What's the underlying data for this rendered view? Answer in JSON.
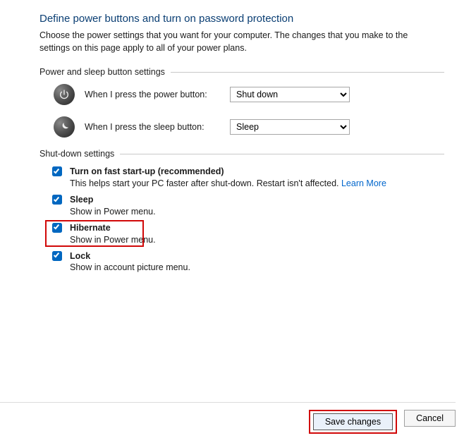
{
  "heading": "Define power buttons and turn on password protection",
  "description": "Choose the power settings that you want for your computer. The changes that you make to the settings on this page apply to all of your power plans.",
  "section_buttons": "Power and sleep button settings",
  "power_button": {
    "label": "When I press the power button:",
    "value": "Shut down"
  },
  "sleep_button": {
    "label": "When I press the sleep button:",
    "value": "Sleep"
  },
  "section_shutdown": "Shut-down settings",
  "settings": {
    "fast_startup": {
      "title": "Turn on fast start-up (recommended)",
      "desc_pre": "This helps start your PC faster after shut-down. Restart isn't affected. ",
      "learn_more": "Learn More"
    },
    "sleep": {
      "title": "Sleep",
      "desc": "Show in Power menu."
    },
    "hibernate": {
      "title": "Hibernate",
      "desc": "Show in Power menu."
    },
    "lock": {
      "title": "Lock",
      "desc": "Show in account picture menu."
    }
  },
  "buttons": {
    "save": "Save changes",
    "cancel": "Cancel"
  }
}
